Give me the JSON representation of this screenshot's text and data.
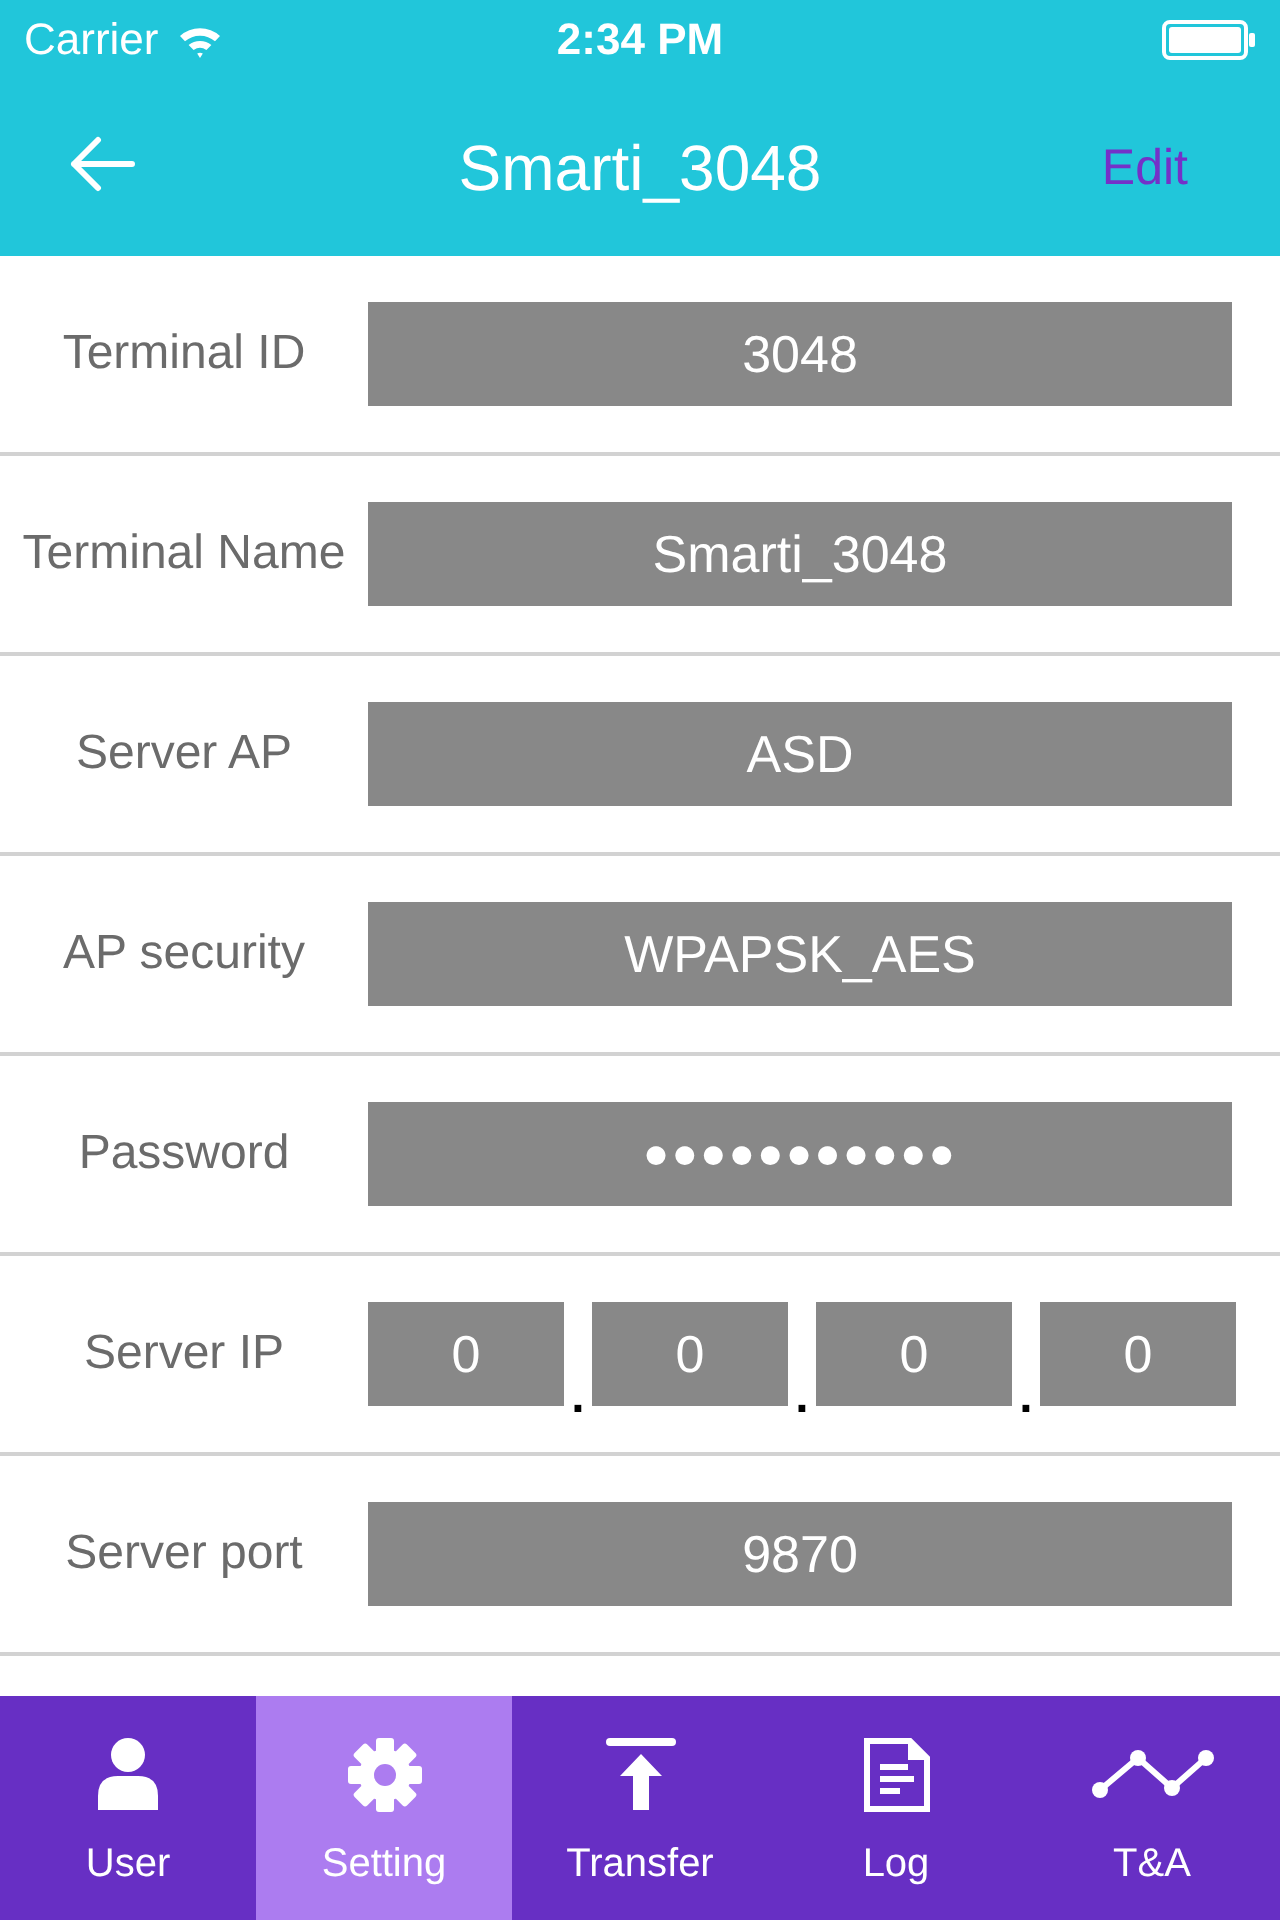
{
  "status_bar": {
    "carrier": "Carrier",
    "time": "2:34 PM"
  },
  "nav_bar": {
    "title": "Smarti_3048",
    "action": "Edit"
  },
  "settings": [
    {
      "kind": "text",
      "label": "Terminal ID",
      "value": "3048"
    },
    {
      "kind": "text",
      "label": "Terminal Name",
      "value": "Smarti_3048"
    },
    {
      "kind": "text",
      "label": "Server AP",
      "value": "ASD"
    },
    {
      "kind": "text",
      "label": "AP security",
      "value": "WPAPSK_AES"
    },
    {
      "kind": "password",
      "label": "Password",
      "value": "●●●●●●●●●●●"
    },
    {
      "kind": "ip",
      "label": "Server IP",
      "separator": ".",
      "segments": [
        "0",
        "0",
        "0",
        "0"
      ]
    },
    {
      "kind": "text",
      "label": "Server port",
      "value": "9870"
    }
  ],
  "tabs": [
    {
      "label": "User",
      "selected": false
    },
    {
      "label": "Setting",
      "selected": true
    },
    {
      "label": "Transfer",
      "selected": false
    },
    {
      "label": "Log",
      "selected": false
    },
    {
      "label": "T&A",
      "selected": false
    }
  ]
}
